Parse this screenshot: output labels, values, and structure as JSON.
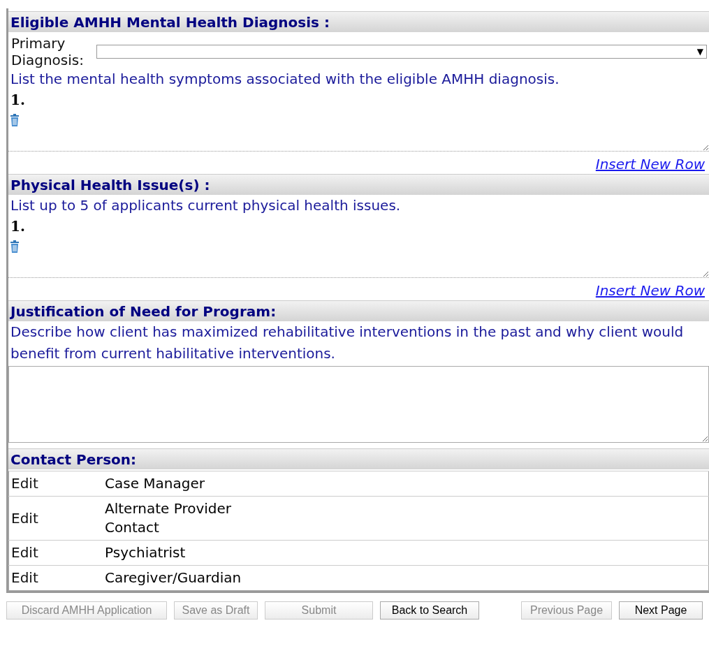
{
  "diagnosis": {
    "title": "Eligible AMHH Mental Health Diagnosis :",
    "primary_label": "Primary Diagnosis:",
    "dropdown_arrow": "▼",
    "instruction": "List the mental health symptoms associated with the eligible AMHH diagnosis.",
    "rows": [
      {
        "number": "1."
      }
    ],
    "insert_link": "Insert New Row"
  },
  "physical": {
    "title": "Physical Health Issue(s) :",
    "instruction": "List up to 5 of applicants current physical health issues.",
    "rows": [
      {
        "number": "1."
      }
    ],
    "insert_link": "Insert New Row"
  },
  "justification": {
    "title": "Justification of Need for Program:",
    "instruction": "Describe how client has maximized rehabilitative interventions in the past and why client would benefit from current habilitative interventions."
  },
  "contacts": {
    "title": "Contact Person:",
    "rows": [
      {
        "action": "Edit",
        "role": "Case Manager"
      },
      {
        "action": "Edit",
        "role": "Alternate Provider Contact"
      },
      {
        "action": "Edit",
        "role": "Psychiatrist"
      },
      {
        "action": "Edit",
        "role": "Caregiver/Guardian"
      }
    ]
  },
  "buttons": [
    {
      "label": "Discard AMHH Application",
      "disabled": true
    },
    {
      "label": "Save as Draft",
      "disabled": true
    },
    {
      "label": "Submit",
      "disabled": true
    },
    {
      "label": "Back to Search",
      "disabled": false
    },
    {
      "label": "Previous Page",
      "disabled": true
    },
    {
      "label": "Next Page",
      "disabled": false
    }
  ]
}
